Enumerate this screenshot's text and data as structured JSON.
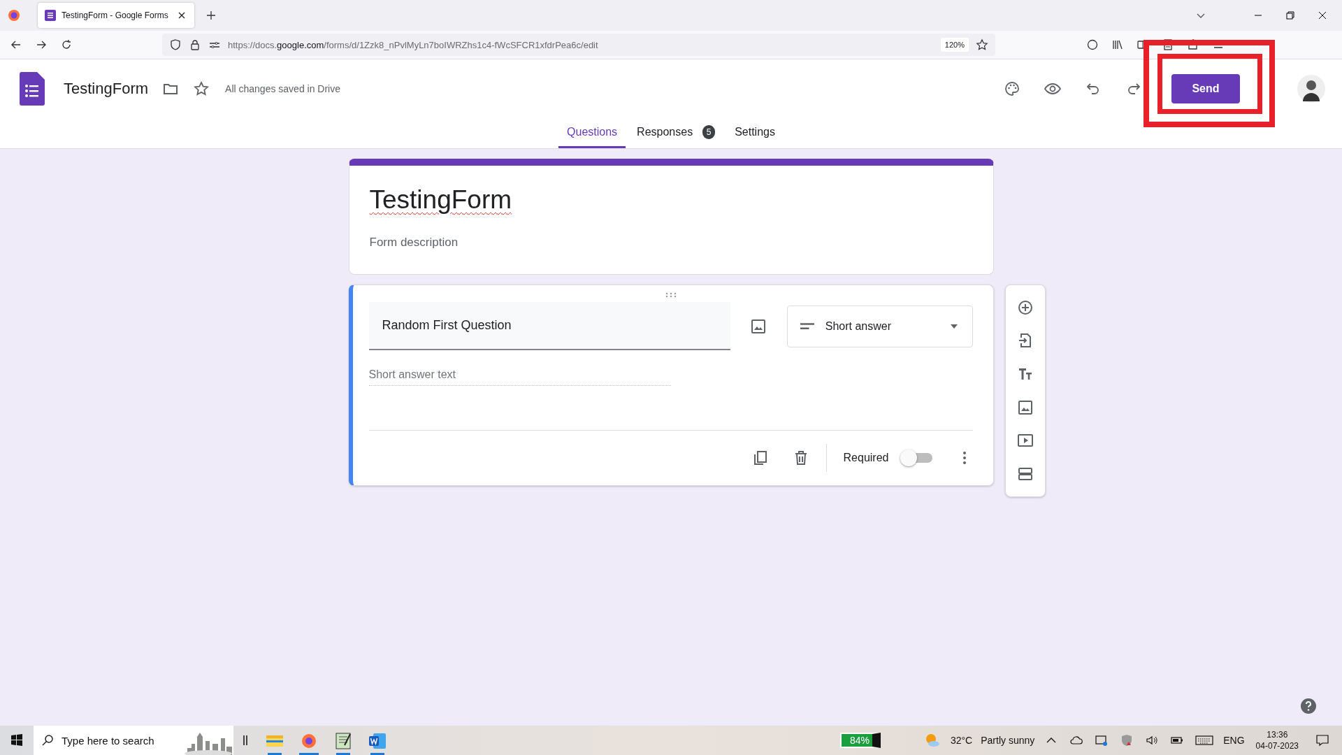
{
  "browser": {
    "tab_title": "TestingForm - Google Forms",
    "url_prefix": "https://docs.",
    "url_host": "google.com",
    "url_path": "/forms/d/1Zzk8_nPvlMyLn7boIWRZhs1c4-fWcSFCR1xfdrPea6c/edit",
    "zoom": "120%"
  },
  "header": {
    "title": "TestingForm",
    "save_status": "All changes saved in Drive",
    "send_label": "Send"
  },
  "tabs": [
    {
      "label": "Questions",
      "selected": true
    },
    {
      "label": "Responses",
      "badge": "5",
      "selected": false
    },
    {
      "label": "Settings",
      "selected": false
    }
  ],
  "form": {
    "title": "TestingForm",
    "description_placeholder": "Form description"
  },
  "question": {
    "title": "Random First Question",
    "type": "Short answer",
    "answer_placeholder": "Short answer text",
    "required_label": "Required",
    "required": false
  },
  "taskbar": {
    "search_placeholder": "Type here to search",
    "battery": "84%",
    "temperature": "32°C",
    "weather": "Partly sunny",
    "language": "ENG",
    "time": "13:36",
    "date": "04-07-2023"
  }
}
